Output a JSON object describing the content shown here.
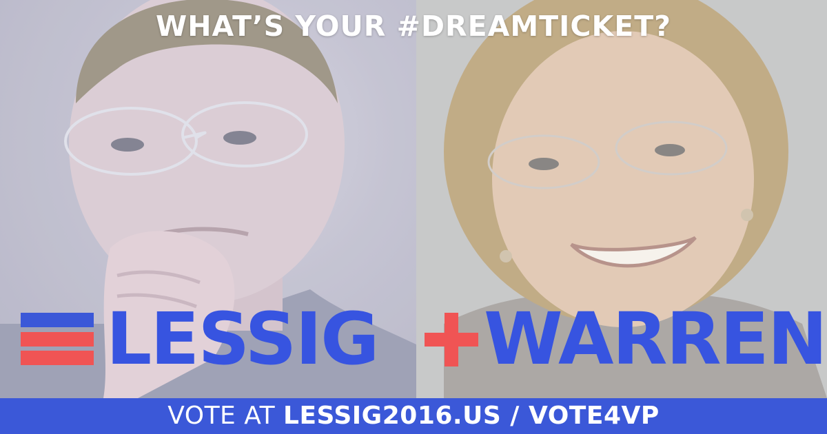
{
  "headline": "WHAT’S YOUR #DREAMTICKET?",
  "logo": {
    "left_name": "LESSIG",
    "right_name": "WARREN"
  },
  "footer": {
    "prefix": "VOTE AT ",
    "link": "LESSIG2016.US / VOTE4VP"
  },
  "colors": {
    "brand_blue": "#3754e0",
    "brand_red": "#f05454",
    "footer_blue": "#3b58d8",
    "headline_text": "#ffffff"
  },
  "icons": {
    "flag": "flag-icon",
    "plus": "plus-icon"
  }
}
